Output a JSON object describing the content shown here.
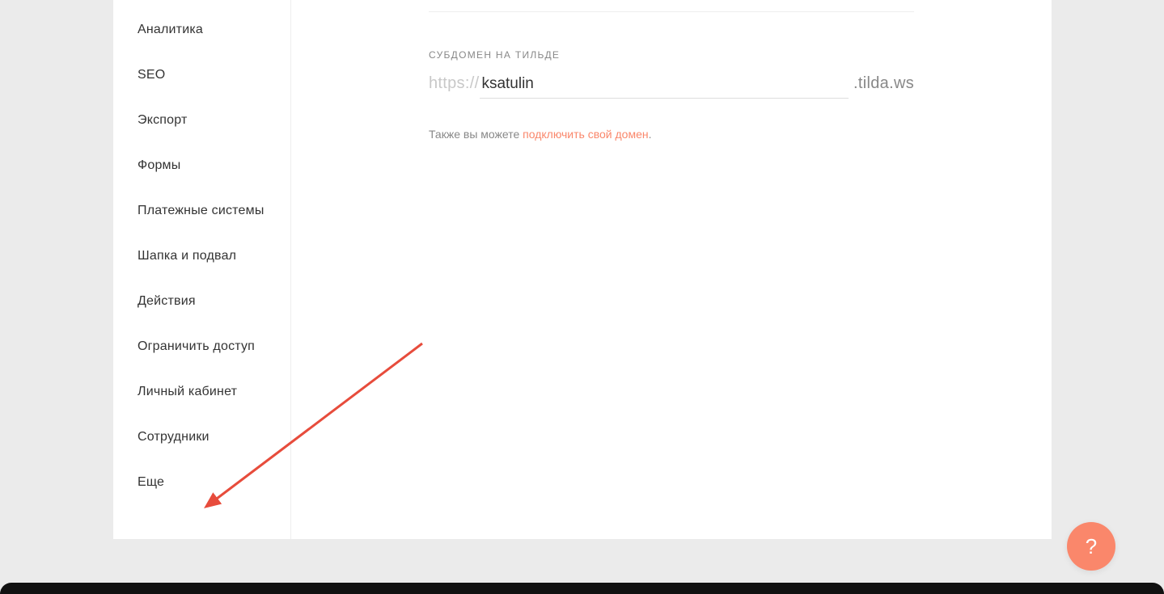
{
  "sidebar": {
    "items": [
      {
        "label": "Аналитика"
      },
      {
        "label": "SEO"
      },
      {
        "label": "Экспорт"
      },
      {
        "label": "Формы"
      },
      {
        "label": "Платежные системы"
      },
      {
        "label": "Шапка и подвал"
      },
      {
        "label": "Действия"
      },
      {
        "label": "Ограничить доступ"
      },
      {
        "label": "Личный кабинет"
      },
      {
        "label": "Сотрудники"
      },
      {
        "label": "Еще"
      }
    ]
  },
  "subdomain": {
    "section_label": "СУБДОМЕН НА ТИЛЬДЕ",
    "prefix": "https://",
    "value": "ksatulin",
    "suffix": ".tilda.ws"
  },
  "hint": {
    "before": "Также вы можете ",
    "link": "подключить свой домен",
    "after": "."
  },
  "help_fab": "?"
}
